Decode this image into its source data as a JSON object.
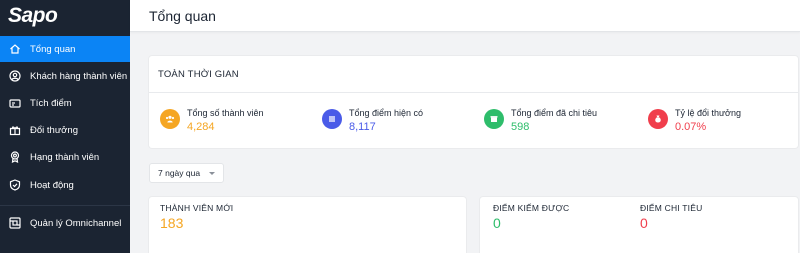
{
  "app": {
    "logo_text": "Sapo"
  },
  "sidebar": {
    "items": [
      {
        "label": "Tổng quan",
        "icon": "home-icon",
        "active": true
      },
      {
        "label": "Khách hàng thành viên",
        "icon": "user-circle-icon",
        "active": false
      },
      {
        "label": "Tích điểm",
        "icon": "card-icon",
        "active": false
      },
      {
        "label": "Đổi thưởng",
        "icon": "gift-icon",
        "active": false
      },
      {
        "label": "Hạng thành viên",
        "icon": "medal-icon",
        "active": false
      },
      {
        "label": "Hoạt động",
        "icon": "shield-icon",
        "active": false
      },
      {
        "label": "Quản lý Omnichannel",
        "icon": "omnichannel-icon",
        "active": false
      }
    ]
  },
  "header": {
    "title": "Tổng quan"
  },
  "overview": {
    "title": "TOÀN THỜI GIAN",
    "stats": [
      {
        "label": "Tổng số thành viên",
        "value": "4,284",
        "color": "#f5a623",
        "icon": "users-icon"
      },
      {
        "label": "Tổng điểm hiện có",
        "value": "8,117",
        "color": "#4a5be8",
        "icon": "list-icon"
      },
      {
        "label": "Tổng điểm đã chi tiêu",
        "value": "598",
        "color": "#2ebd6b",
        "icon": "box-icon"
      },
      {
        "label": "Tỷ lệ đổi thưởng",
        "value": "0.07%",
        "color": "#f03e4c",
        "icon": "money-bag-icon"
      }
    ]
  },
  "filter": {
    "selected": "7 ngày qua"
  },
  "new_members": {
    "label": "THÀNH VIÊN MỚI",
    "value": "183",
    "color": "#f5a623"
  },
  "points": {
    "earned_label": "ĐIỂM KIẾM ĐƯỢC",
    "earned_value": "0",
    "earned_color": "#2ebd6b",
    "spent_label": "ĐIỂM CHI TIÊU",
    "spent_value": "0",
    "spent_color": "#f03e4c"
  },
  "colors": {
    "sidebar_bg": "#1b2432",
    "accent": "#0b84f5"
  }
}
